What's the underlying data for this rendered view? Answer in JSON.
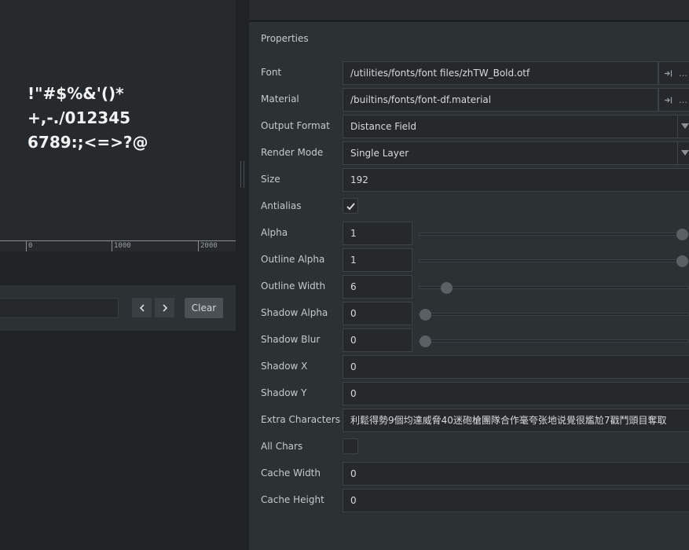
{
  "preview": {
    "lines": [
      "!\"#$%&'()*",
      "+,-./012345",
      "6789:;<=>?@"
    ]
  },
  "ruler": {
    "labels": [
      "0",
      "1000",
      "2000"
    ]
  },
  "console": {
    "clear_label": "Clear",
    "input_value": ""
  },
  "properties": {
    "title": "Properties",
    "font": {
      "label": "Font",
      "value": "/utilities/fonts/font files/zhTW_Bold.otf"
    },
    "material": {
      "label": "Material",
      "value": "/builtins/fonts/font-df.material"
    },
    "output_format": {
      "label": "Output Format",
      "value": "Distance Field"
    },
    "render_mode": {
      "label": "Render Mode",
      "value": "Single Layer"
    },
    "size": {
      "label": "Size",
      "value": "192"
    },
    "antialias": {
      "label": "Antialias",
      "checked": true
    },
    "alpha": {
      "label": "Alpha",
      "value": "1",
      "slider_fraction": 1.0
    },
    "outline_alpha": {
      "label": "Outline Alpha",
      "value": "1",
      "slider_fraction": 1.0
    },
    "outline_width": {
      "label": "Outline Width",
      "value": "6",
      "slider_fraction": 0.1
    },
    "shadow_alpha": {
      "label": "Shadow Alpha",
      "value": "0",
      "slider_fraction": 0.0
    },
    "shadow_blur": {
      "label": "Shadow Blur",
      "value": "0",
      "slider_fraction": 0.0
    },
    "shadow_x": {
      "label": "Shadow X",
      "value": "0"
    },
    "shadow_y": {
      "label": "Shadow Y",
      "value": "0"
    },
    "extra_characters": {
      "label": "Extra Characters",
      "value": "利鬆得勢9個均達威脅40迷砲槍團隊合作毫夸张地说覺很尷尬7戳鬥頭目奪取"
    },
    "all_chars": {
      "label": "All Chars",
      "checked": false
    },
    "cache_width": {
      "label": "Cache Width",
      "value": "0"
    },
    "cache_height": {
      "label": "Cache Height",
      "value": "0"
    }
  },
  "icons": {
    "path_open": "arrow-into-bar-icon",
    "path_browse": "ellipsis-icon",
    "select": "chevron-down-icon",
    "check": "check-icon",
    "nav_prev": "chevron-left-icon",
    "nav_next": "chevron-right-icon"
  }
}
